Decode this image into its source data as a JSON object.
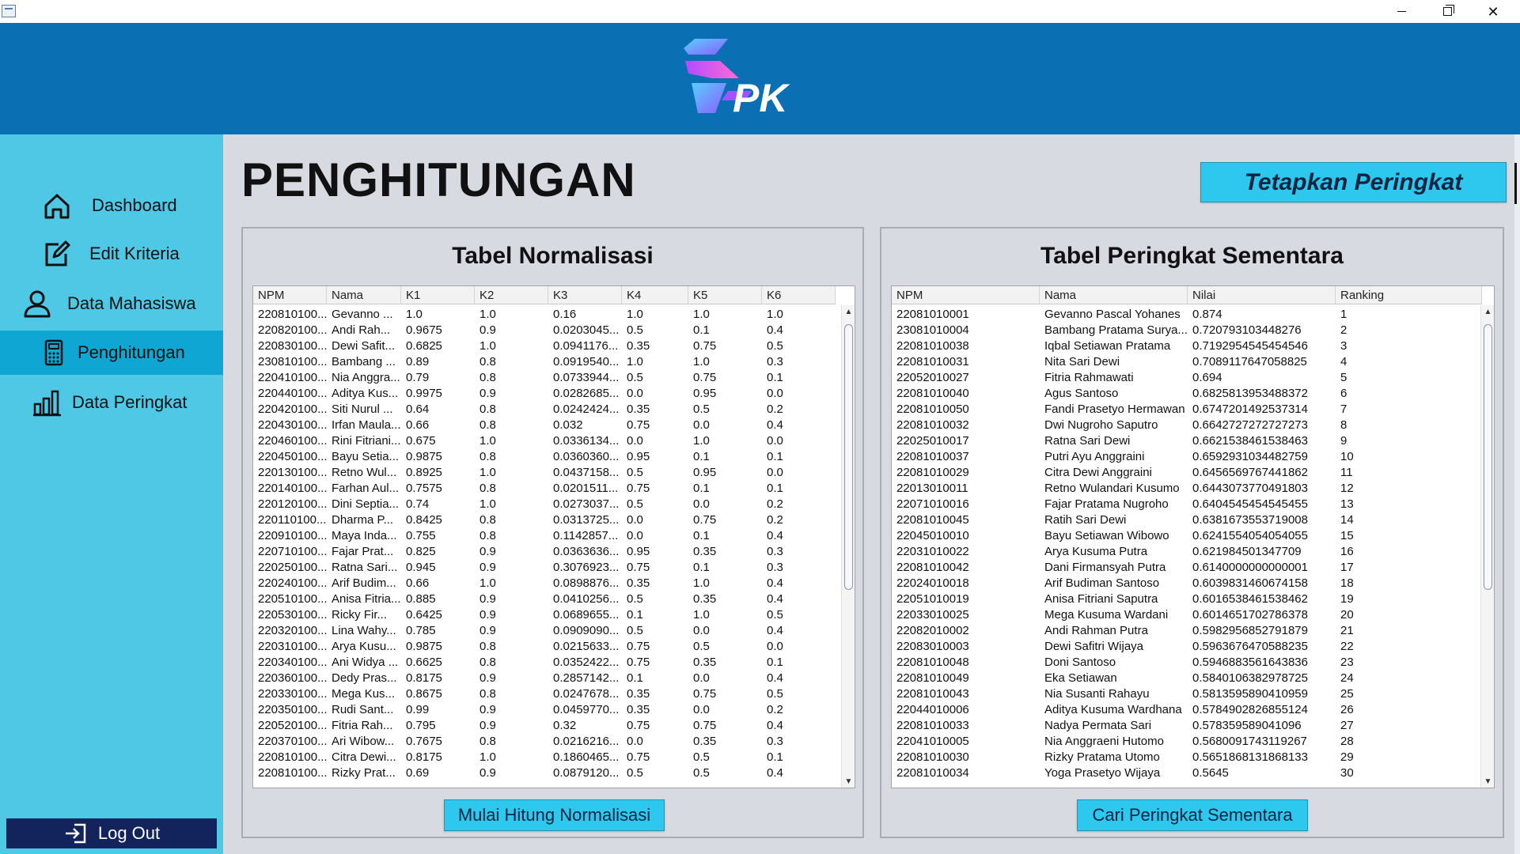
{
  "header": {
    "logo_text": "PK"
  },
  "sidebar": {
    "items": [
      {
        "label": "Dashboard",
        "icon": "home-icon"
      },
      {
        "label": "Edit Kriteria",
        "icon": "edit-icon"
      },
      {
        "label": "Data Mahasiswa",
        "icon": "user-icon"
      },
      {
        "label": "Penghitungan",
        "icon": "calculator-icon",
        "active": true
      },
      {
        "label": "Data Peringkat",
        "icon": "bar-chart-icon"
      }
    ],
    "logout_label": "Log Out"
  },
  "main": {
    "title": "PENGHITUNGAN",
    "rank_button_label": "Tetapkan Peringkat"
  },
  "normalisasi": {
    "title": "Tabel Normalisasi",
    "columns": [
      "NPM",
      "Nama",
      "K1",
      "K2",
      "K3",
      "K4",
      "K5",
      "K6"
    ],
    "rows": [
      [
        "220810100...",
        "Gevanno ...",
        "1.0",
        "1.0",
        "0.16",
        "1.0",
        "1.0",
        "1.0"
      ],
      [
        "220820100...",
        "Andi Rah...",
        "0.9675",
        "0.9",
        "0.0203045...",
        "0.5",
        "0.1",
        "0.4"
      ],
      [
        "220830100...",
        "Dewi Safit...",
        "0.6825",
        "1.0",
        "0.0941176...",
        "0.35",
        "0.75",
        "0.5"
      ],
      [
        "230810100...",
        "Bambang ...",
        "0.89",
        "0.8",
        "0.0919540...",
        "1.0",
        "1.0",
        "0.3"
      ],
      [
        "220410100...",
        "Nia Anggra...",
        "0.79",
        "0.8",
        "0.0733944...",
        "0.5",
        "0.75",
        "0.1"
      ],
      [
        "220440100...",
        "Aditya Kus...",
        "0.9975",
        "0.9",
        "0.0282685...",
        "0.0",
        "0.95",
        "0.0"
      ],
      [
        "220420100...",
        "Siti Nurul ...",
        "0.64",
        "0.8",
        "0.0242424...",
        "0.35",
        "0.5",
        "0.2"
      ],
      [
        "220430100...",
        "Irfan Maula...",
        "0.66",
        "0.8",
        "0.032",
        "0.75",
        "0.0",
        "0.4"
      ],
      [
        "220460100...",
        "Rini Fitriani...",
        "0.675",
        "1.0",
        "0.0336134...",
        "0.0",
        "1.0",
        "0.0"
      ],
      [
        "220450100...",
        "Bayu Setia...",
        "0.9875",
        "0.8",
        "0.0360360...",
        "0.95",
        "0.1",
        "0.1"
      ],
      [
        "220130100...",
        "Retno Wul...",
        "0.8925",
        "1.0",
        "0.0437158...",
        "0.5",
        "0.95",
        "0.0"
      ],
      [
        "220140100...",
        "Farhan Aul...",
        "0.7575",
        "0.8",
        "0.0201511...",
        "0.75",
        "0.1",
        "0.1"
      ],
      [
        "220120100...",
        "Dini Septia...",
        "0.74",
        "1.0",
        "0.0273037...",
        "0.5",
        "0.0",
        "0.2"
      ],
      [
        "220110100...",
        "Dharma P...",
        "0.8425",
        "0.8",
        "0.0313725...",
        "0.0",
        "0.75",
        "0.2"
      ],
      [
        "220910100...",
        "Maya Inda...",
        "0.755",
        "0.8",
        "0.1142857...",
        "0.0",
        "0.1",
        "0.4"
      ],
      [
        "220710100...",
        "Fajar Prat...",
        "0.825",
        "0.9",
        "0.0363636...",
        "0.95",
        "0.35",
        "0.3"
      ],
      [
        "220250100...",
        "Ratna Sari...",
        "0.945",
        "0.9",
        "0.3076923...",
        "0.75",
        "0.1",
        "0.3"
      ],
      [
        "220240100...",
        "Arif Budim...",
        "0.66",
        "1.0",
        "0.0898876...",
        "0.35",
        "1.0",
        "0.4"
      ],
      [
        "220510100...",
        "Anisa Fitria...",
        "0.885",
        "0.9",
        "0.0410256...",
        "0.5",
        "0.35",
        "0.4"
      ],
      [
        "220530100...",
        "Ricky Fir...",
        "0.6425",
        "0.9",
        "0.0689655...",
        "0.1",
        "1.0",
        "0.5"
      ],
      [
        "220320100...",
        "Lina Wahy...",
        "0.785",
        "0.9",
        "0.0909090...",
        "0.5",
        "0.0",
        "0.4"
      ],
      [
        "220310100...",
        "Arya Kusu...",
        "0.9875",
        "0.8",
        "0.0215633...",
        "0.75",
        "0.5",
        "0.0"
      ],
      [
        "220340100...",
        "Ani Widya ...",
        "0.6625",
        "0.8",
        "0.0352422...",
        "0.75",
        "0.35",
        "0.1"
      ],
      [
        "220360100...",
        "Dedy Pras...",
        "0.8175",
        "0.9",
        "0.2857142...",
        "0.1",
        "0.0",
        "0.4"
      ],
      [
        "220330100...",
        "Mega Kus...",
        "0.8675",
        "0.8",
        "0.0247678...",
        "0.35",
        "0.75",
        "0.5"
      ],
      [
        "220350100...",
        "Rudi Sant...",
        "0.99",
        "0.9",
        "0.0459770...",
        "0.35",
        "0.0",
        "0.2"
      ],
      [
        "220520100...",
        "Fitria Rah...",
        "0.795",
        "0.9",
        "0.32",
        "0.75",
        "0.75",
        "0.4"
      ],
      [
        "220370100...",
        "Ari Wibow...",
        "0.7675",
        "0.8",
        "0.0216216...",
        "0.0",
        "0.35",
        "0.3"
      ],
      [
        "220810100...",
        "Citra Dewi...",
        "0.8175",
        "1.0",
        "0.1860465...",
        "0.75",
        "0.5",
        "0.1"
      ],
      [
        "220810100...",
        "Rizky Prat...",
        "0.69",
        "0.9",
        "0.0879120...",
        "0.5",
        "0.5",
        "0.4"
      ]
    ],
    "button_label": "Mulai Hitung Normalisasi"
  },
  "peringkat": {
    "title": "Tabel Peringkat Sementara",
    "columns": [
      "NPM",
      "Nama",
      "Nilai",
      "Ranking"
    ],
    "rows": [
      [
        "22081010001",
        "Gevanno Pascal Yohanes",
        "0.874",
        "1"
      ],
      [
        "23081010004",
        "Bambang Pratama Surya...",
        "0.720793103448276",
        "2"
      ],
      [
        "22081010038",
        "Iqbal Setiawan Pratama",
        "0.7192954545454546",
        "3"
      ],
      [
        "22081010031",
        "Nita Sari Dewi",
        "0.7089117647058825",
        "4"
      ],
      [
        "22052010027",
        "Fitria Rahmawati",
        "0.694",
        "5"
      ],
      [
        "22081010040",
        "Agus Santoso",
        "0.6825813953488372",
        "6"
      ],
      [
        "22081010050",
        "Fandi Prasetyo Hermawan",
        "0.6747201492537314",
        "7"
      ],
      [
        "22081010032",
        "Dwi Nugroho Saputro",
        "0.6642727272727273",
        "8"
      ],
      [
        "22025010017",
        "Ratna Sari Dewi",
        "0.6621538461538463",
        "9"
      ],
      [
        "22081010037",
        "Putri Ayu Anggraini",
        "0.6592931034482759",
        "10"
      ],
      [
        "22081010029",
        "Citra Dewi Anggraini",
        "0.6456569767441862",
        "11"
      ],
      [
        "22013010011",
        "Retno Wulandari Kusumo",
        "0.6443073770491803",
        "12"
      ],
      [
        "22071010016",
        "Fajar Pratama Nugroho",
        "0.6404545454545455",
        "13"
      ],
      [
        "22081010045",
        "Ratih Sari Dewi",
        "0.6381673553719008",
        "14"
      ],
      [
        "22045010010",
        "Bayu Setiawan Wibowo",
        "0.6241554054054055",
        "15"
      ],
      [
        "22031010022",
        "Arya Kusuma Putra",
        "0.621984501347709",
        "16"
      ],
      [
        "22081010042",
        "Dani Firmansyah Putra",
        "0.6140000000000001",
        "17"
      ],
      [
        "22024010018",
        "Arif Budiman Santoso",
        "0.6039831460674158",
        "18"
      ],
      [
        "22051010019",
        "Anisa Fitriani Saputra",
        "0.6016538461538462",
        "19"
      ],
      [
        "22033010025",
        "Mega Kusuma Wardani",
        "0.6014651702786378",
        "20"
      ],
      [
        "22082010002",
        "Andi Rahman Putra",
        "0.5982956852791879",
        "21"
      ],
      [
        "22083010003",
        "Dewi Safitri Wijaya",
        "0.5963676470588235",
        "22"
      ],
      [
        "22081010048",
        "Doni Santoso",
        "0.5946883561643836",
        "23"
      ],
      [
        "22081010049",
        "Eka Setiawan",
        "0.5840106382978725",
        "24"
      ],
      [
        "22081010043",
        "Nia Susanti Rahayu",
        "0.5813595890410959",
        "25"
      ],
      [
        "22044010006",
        "Aditya Kusuma Wardhana",
        "0.5784902826855124",
        "26"
      ],
      [
        "22081010033",
        "Nadya Permata Sari",
        "0.578359589041096",
        "27"
      ],
      [
        "22041010005",
        "Nia Anggraeni Hutomo",
        "0.5680091743119267",
        "28"
      ],
      [
        "22081010030",
        "Rizky Pratama Utomo",
        "0.5651868131868133",
        "29"
      ],
      [
        "22081010034",
        "Yoga Prasetyo Wijaya",
        "0.5645",
        "30"
      ]
    ],
    "button_label": "Cari Peringkat Sementara"
  }
}
